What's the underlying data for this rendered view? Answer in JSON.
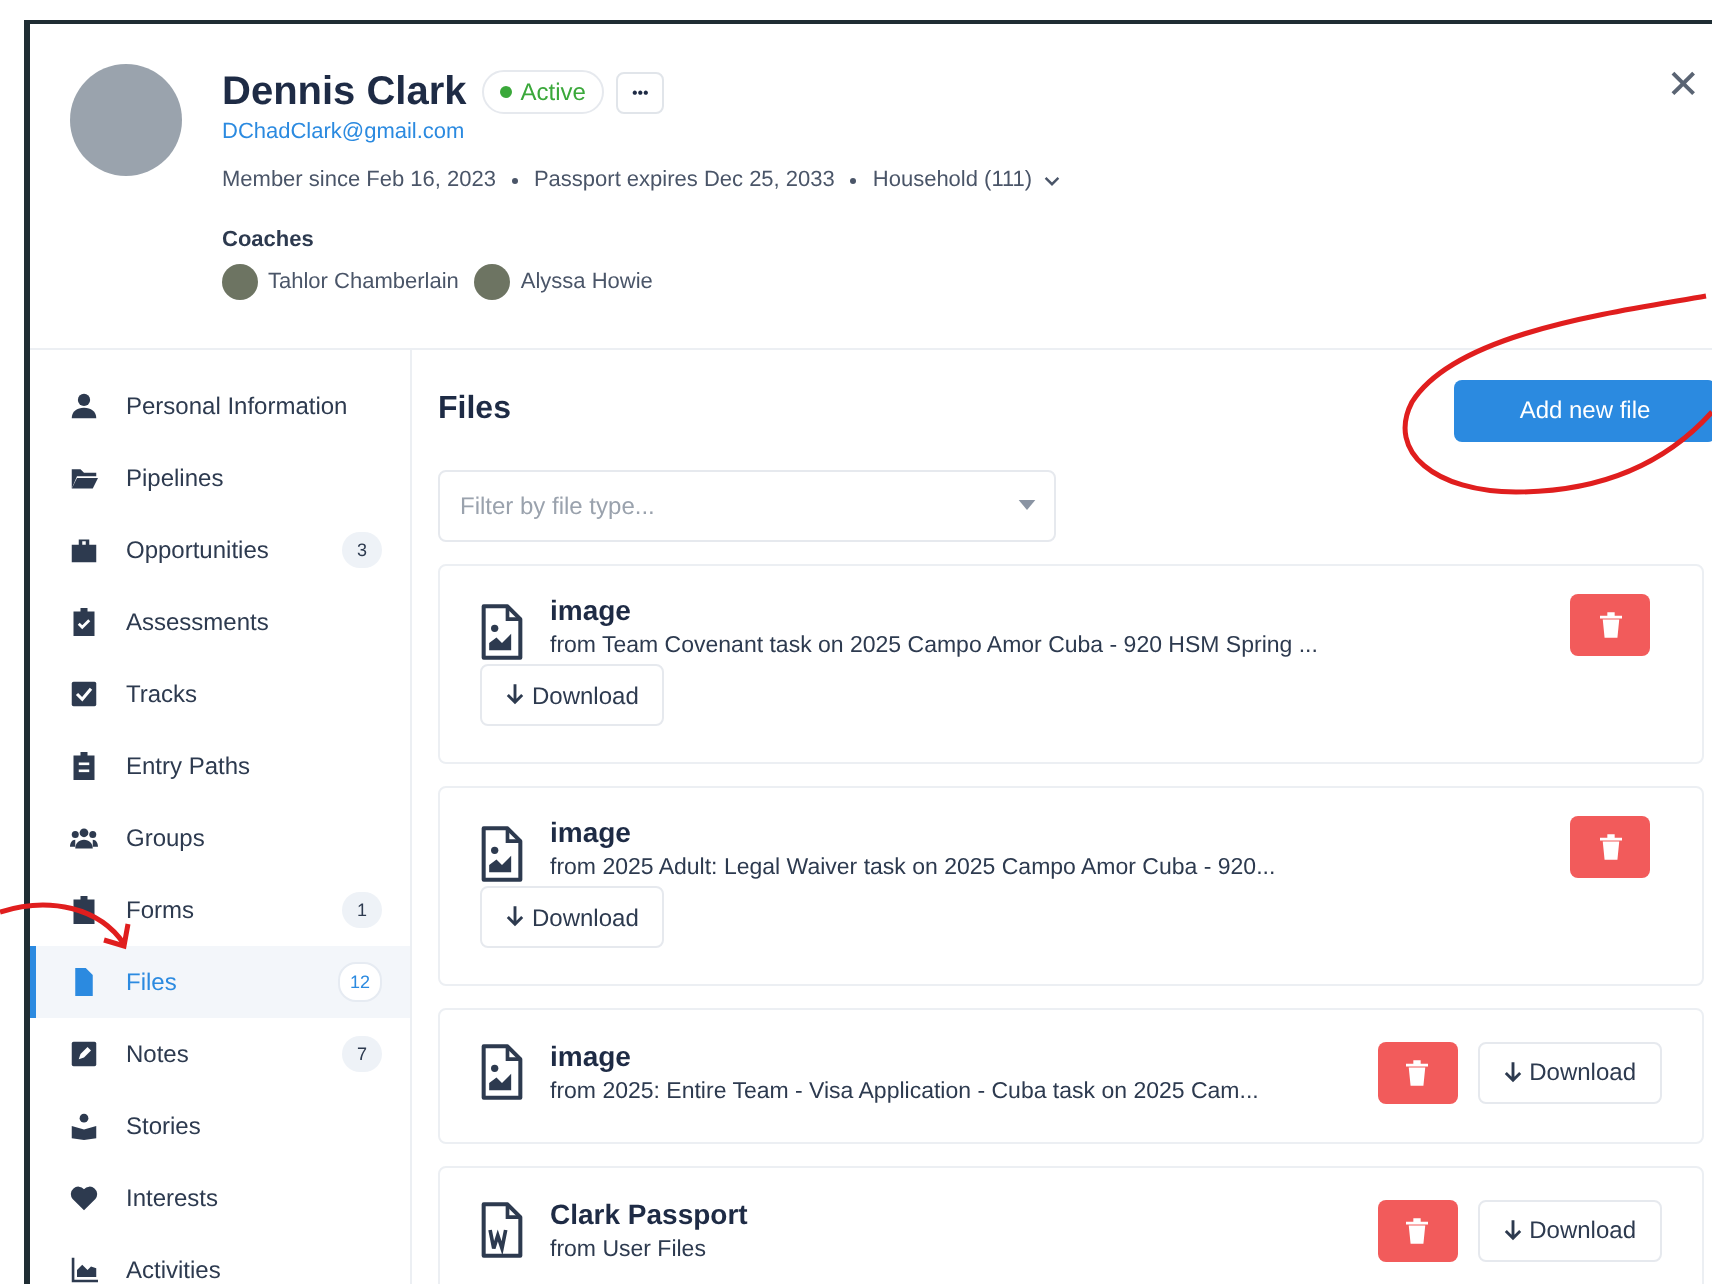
{
  "profile": {
    "name": "Dennis Clark",
    "status": "Active",
    "more_label": "•••",
    "email": "DChadClark@gmail.com",
    "meta": [
      "Member since Feb 16, 2023",
      "Passport expires Dec 25, 2033",
      "Household (111)"
    ],
    "coaches_label": "Coaches",
    "coaches": [
      "Tahlor Chamberlain",
      "Alyssa Howie"
    ],
    "close": "✕"
  },
  "sidebar": {
    "items": [
      {
        "label": "Personal Information",
        "selected": false
      },
      {
        "label": "Pipelines",
        "selected": false
      },
      {
        "label": "Opportunities",
        "count": "3",
        "selected": false
      },
      {
        "label": "Assessments",
        "selected": false
      },
      {
        "label": "Tracks",
        "selected": false
      },
      {
        "label": "Entry Paths",
        "selected": false
      },
      {
        "label": "Groups",
        "selected": false
      },
      {
        "label": "Forms",
        "count": "1",
        "selected": false
      },
      {
        "label": "Files",
        "count": "12",
        "selected": true
      },
      {
        "label": "Notes",
        "count": "7",
        "selected": false
      },
      {
        "label": "Stories",
        "selected": false
      },
      {
        "label": "Interests",
        "selected": false
      },
      {
        "label": "Activities",
        "selected": false
      }
    ]
  },
  "files": {
    "title": "Files",
    "add_button": "Add new file",
    "filter": {
      "placeholder": "Filter by file type..."
    },
    "items": [
      {
        "kind": "stacked",
        "name": "image",
        "source": "from Team Covenant task on 2025 Campo Amor Cuba - 920 HSM Spring ...",
        "download": "Download"
      },
      {
        "kind": "stacked",
        "name": "image",
        "source": "from 2025 Adult: Legal Waiver task on 2025 Campo Amor Cuba - 920...",
        "download": "Download"
      },
      {
        "kind": "inline",
        "name": "image",
        "source": "from 2025: Entire Team - Visa Application - Cuba task on 2025 Cam...",
        "download": "Download"
      },
      {
        "kind": "document",
        "name": "Clark Passport",
        "source": "from User Files",
        "download": "Download"
      }
    ]
  }
}
